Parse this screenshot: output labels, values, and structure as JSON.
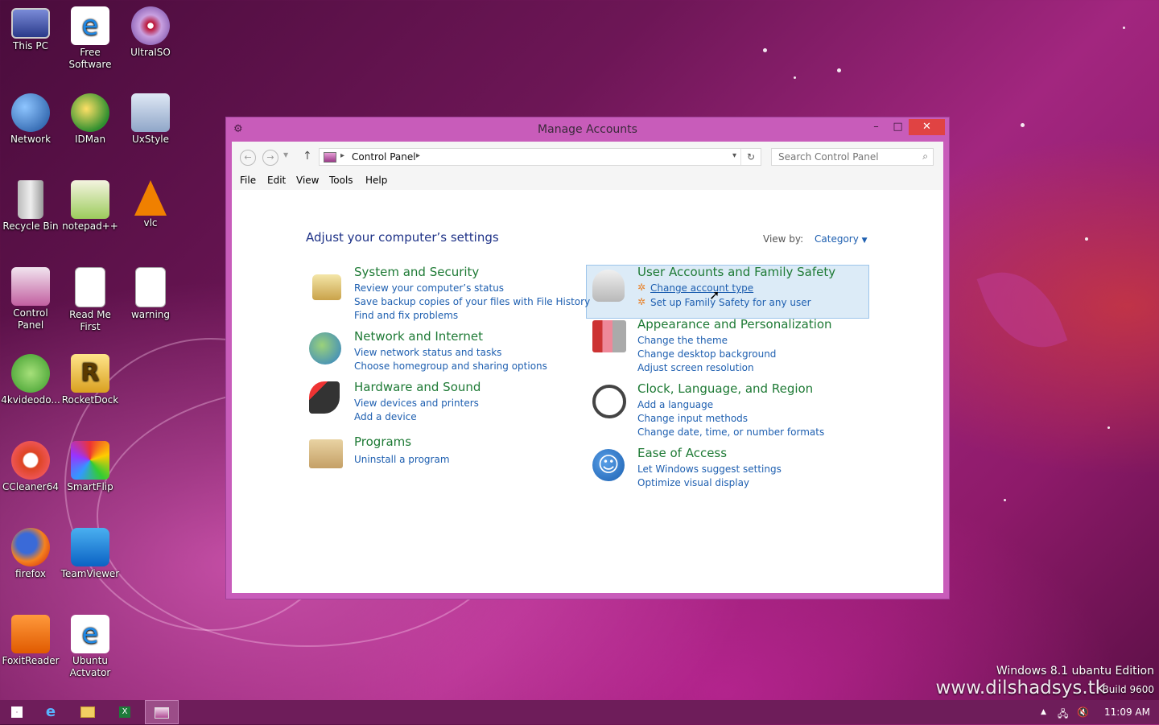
{
  "desktop": {
    "icons": [
      {
        "label": "This PC"
      },
      {
        "label": "Free Software"
      },
      {
        "label": "UltraISO"
      },
      {
        "label": "Network"
      },
      {
        "label": "IDMan"
      },
      {
        "label": "UxStyle"
      },
      {
        "label": "Recycle Bin"
      },
      {
        "label": "notepad++"
      },
      {
        "label": "vlc"
      },
      {
        "label": "Control Panel"
      },
      {
        "label": "Read Me First"
      },
      {
        "label": "warning"
      },
      {
        "label": "4kvideodo..."
      },
      {
        "label": "RocketDock"
      },
      {
        "label": "CCleaner64"
      },
      {
        "label": "SmartFlip"
      },
      {
        "label": "firefox"
      },
      {
        "label": "TeamViewer"
      },
      {
        "label": "FoxitReader"
      },
      {
        "label": "Ubuntu Actvator"
      }
    ],
    "watermark_line1": "Windows 8.1 ubantu Edition",
    "watermark_line2": "www.dilshadsys.tk",
    "watermark_build": "Build 9600"
  },
  "window": {
    "title": "Manage Accounts",
    "minimize": "–",
    "maximize": "□",
    "close": "✕",
    "nav": {
      "back": "←",
      "forward": "→",
      "up": "↑",
      "breadcrumb": "Control Panel",
      "refresh": "↻",
      "search_placeholder": "Search Control Panel"
    },
    "menu": [
      "File",
      "Edit",
      "View",
      "Tools",
      "Help"
    ],
    "heading": "Adjust your computer’s settings",
    "view_by_label": "View by:",
    "view_by_value": "Category",
    "categories": [
      {
        "title": "System and Security",
        "links": [
          "Review your computer’s status",
          "Save backup copies of your files with File History",
          "Find and fix problems"
        ]
      },
      {
        "title": "Network and Internet",
        "links": [
          "View network status and tasks",
          "Choose homegroup and sharing options"
        ]
      },
      {
        "title": "Hardware and Sound",
        "links": [
          "View devices and printers",
          "Add a device"
        ]
      },
      {
        "title": "Programs",
        "links": [
          "Uninstall a program"
        ]
      },
      {
        "title": "User Accounts and Family Safety",
        "links": [
          "Change account type",
          "Set up Family Safety for any user"
        ]
      },
      {
        "title": "Appearance and Personalization",
        "links": [
          "Change the theme",
          "Change desktop background",
          "Adjust screen resolution"
        ]
      },
      {
        "title": "Clock, Language, and Region",
        "links": [
          "Add a language",
          "Change input methods",
          "Change date, time, or number formats"
        ]
      },
      {
        "title": "Ease of Access",
        "links": [
          "Let Windows suggest settings",
          "Optimize visual display"
        ]
      }
    ]
  },
  "taskbar": {
    "clock": "11:09 AM",
    "items": [
      "start",
      "internet-explorer",
      "file-explorer",
      "excel",
      "control-panel"
    ]
  }
}
